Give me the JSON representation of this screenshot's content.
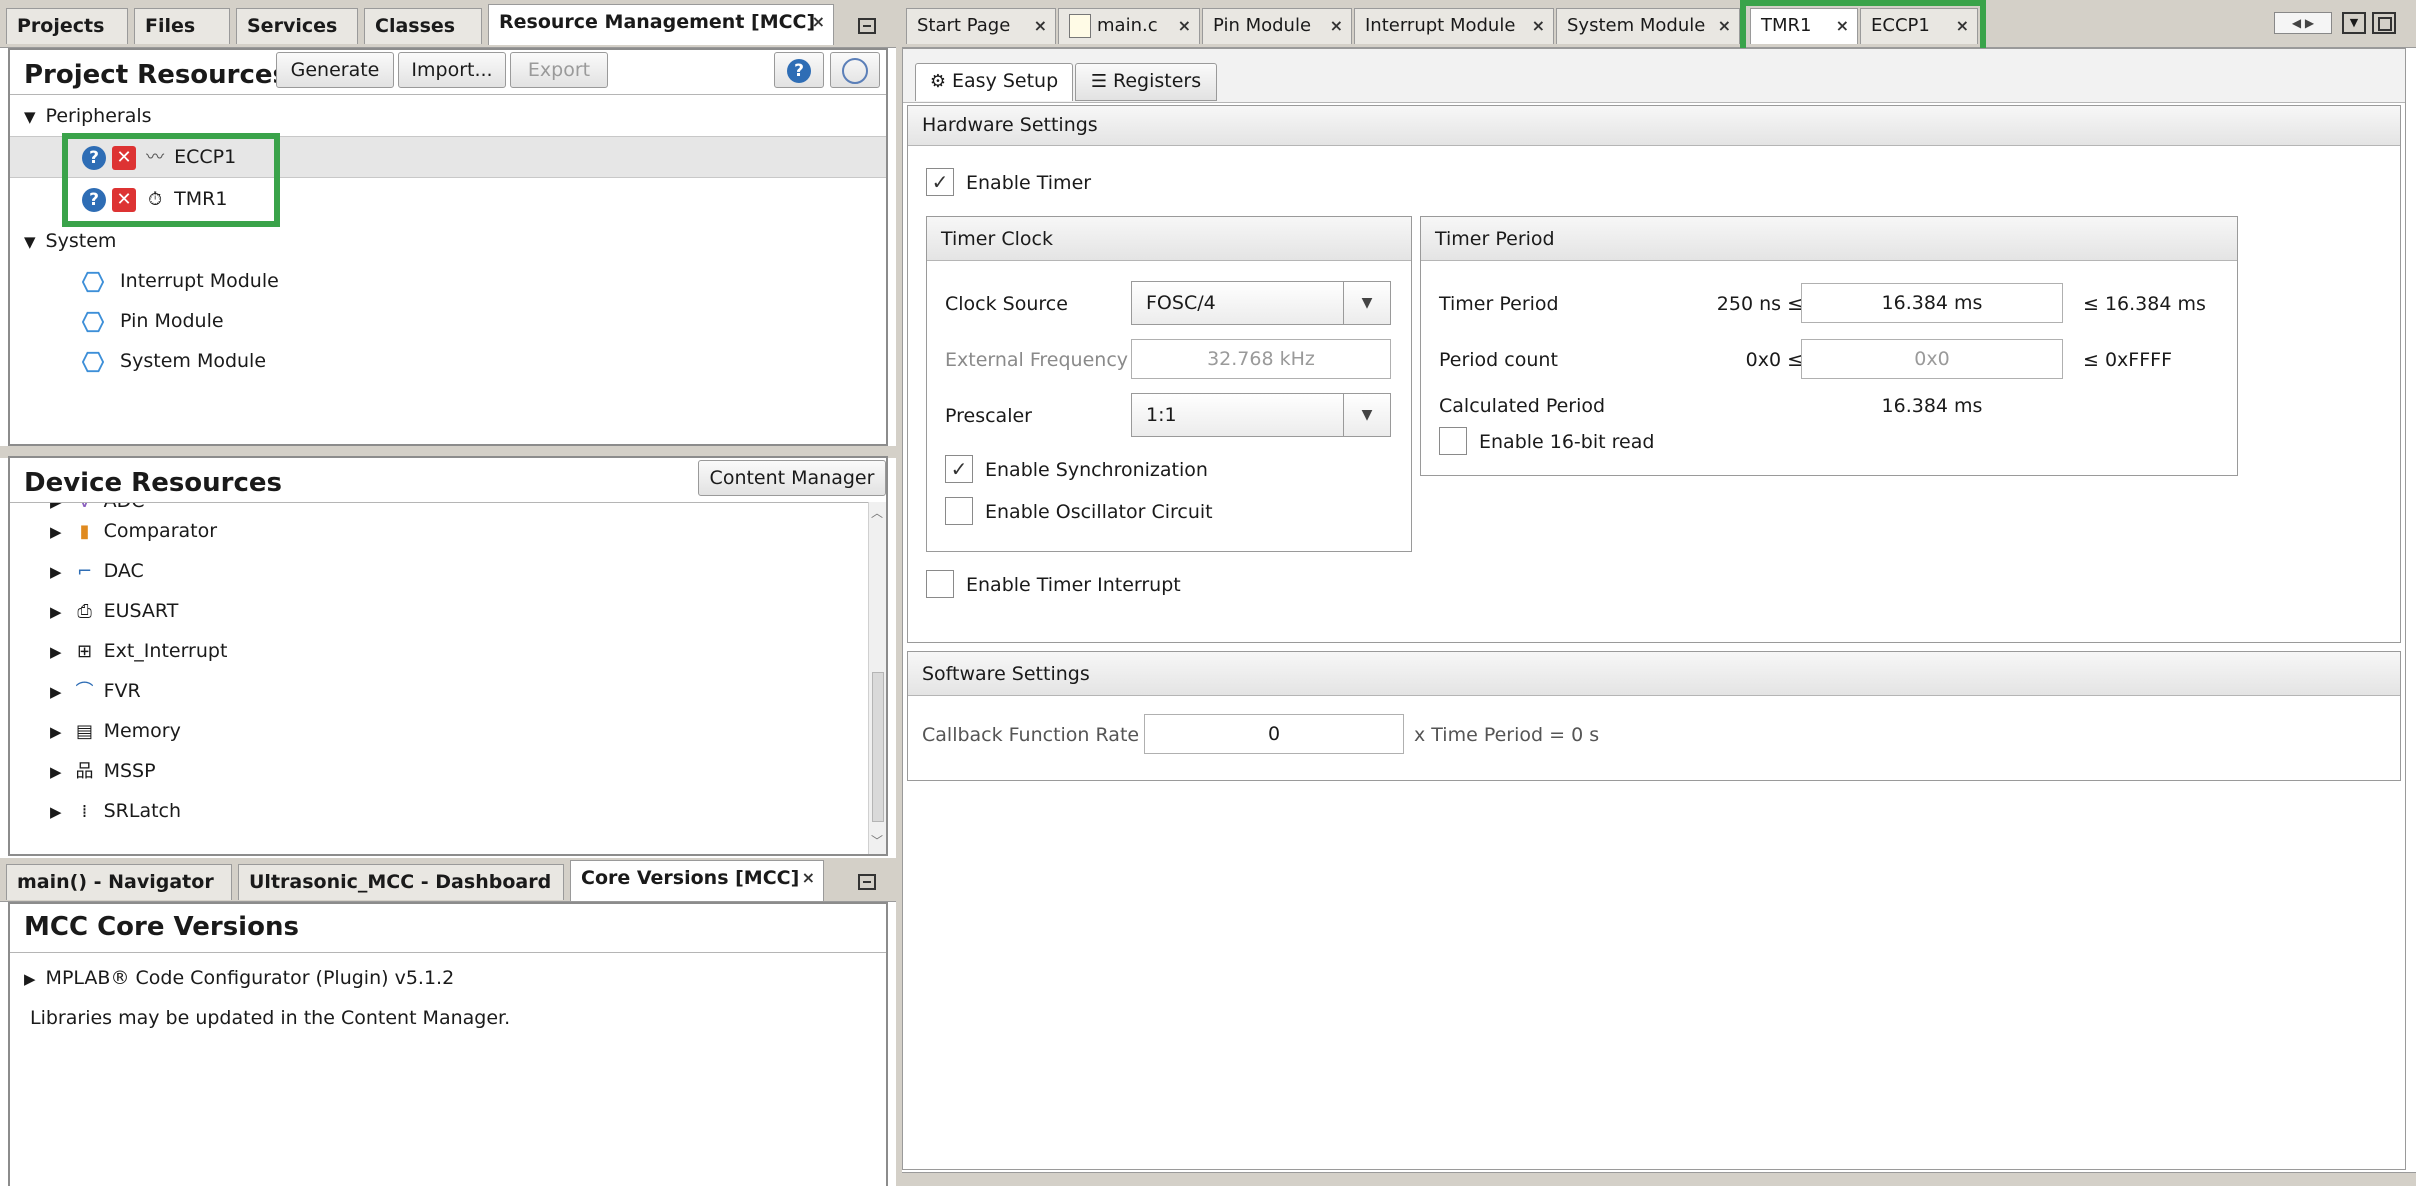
{
  "left_top_tabs": [
    "Projects",
    "Files",
    "Services",
    "Classes",
    "Resource Management [MCC]"
  ],
  "left_top_active_close": "×",
  "project_resources": {
    "title": "Project Resources",
    "buttons": {
      "generate": "Generate",
      "import": "Import...",
      "export": "Export"
    },
    "peripherals_label": "Peripherals",
    "peripherals": [
      "ECCP1",
      "TMR1"
    ],
    "system_label": "System",
    "system_items": [
      "Interrupt Module",
      "Pin Module",
      "System Module"
    ]
  },
  "device_resources": {
    "title": "Device Resources",
    "content_manager_button": "Content Manager",
    "partial_item": "ADC",
    "items": [
      "Comparator",
      "DAC",
      "EUSART",
      "Ext_Interrupt",
      "FVR",
      "Memory",
      "MSSP",
      "SRLatch"
    ]
  },
  "left_bottom_tabs": [
    "main() - Navigator",
    "Ultrasonic_MCC - Dashboard",
    "Core Versions [MCC]"
  ],
  "core_versions": {
    "title": "MCC Core Versions",
    "plugin_line": "MPLAB® Code Configurator (Plugin) v5.1.2",
    "libraries_note": "Libraries may be updated in the Content Manager."
  },
  "editor_tabs": [
    "Start Page",
    "main.c",
    "Pin Module",
    "Interrupt Module",
    "System Module",
    "TMR1",
    "ECCP1"
  ],
  "subtabs": {
    "easy_setup": "Easy Setup",
    "registers": "Registers"
  },
  "hardware_settings": {
    "title": "Hardware Settings",
    "enable_timer": "Enable Timer",
    "timer_clock": {
      "title": "Timer Clock",
      "clock_source_label": "Clock Source",
      "clock_source_value": "FOSC/4",
      "external_frequency_label": "External Frequency",
      "external_frequency_value": "32.768 kHz",
      "prescaler_label": "Prescaler",
      "prescaler_value": "1:1",
      "enable_sync": "Enable Synchronization",
      "enable_osc": "Enable Oscillator Circuit"
    },
    "timer_period": {
      "title": "Timer Period",
      "period_label": "Timer Period",
      "period_min": "250 ns ≤",
      "period_value": "16.384 ms",
      "period_max": "≤ 16.384 ms",
      "count_label": "Period count",
      "count_min": "0x0 ≤",
      "count_value": "0x0",
      "count_max": "≤ 0xFFFF",
      "calc_label": "Calculated Period",
      "calc_value": "16.384 ms",
      "enable_16bit": "Enable 16-bit read"
    },
    "enable_interrupt": "Enable Timer Interrupt"
  },
  "software_settings": {
    "title": "Software Settings",
    "callback_label": "Callback Function Rate",
    "callback_value": "0",
    "callback_suffix": "x Time Period = 0 s"
  },
  "colors": {
    "highlight": "#3aa34a",
    "help_blue": "#2e6db5",
    "remove_red": "#dd3333"
  }
}
